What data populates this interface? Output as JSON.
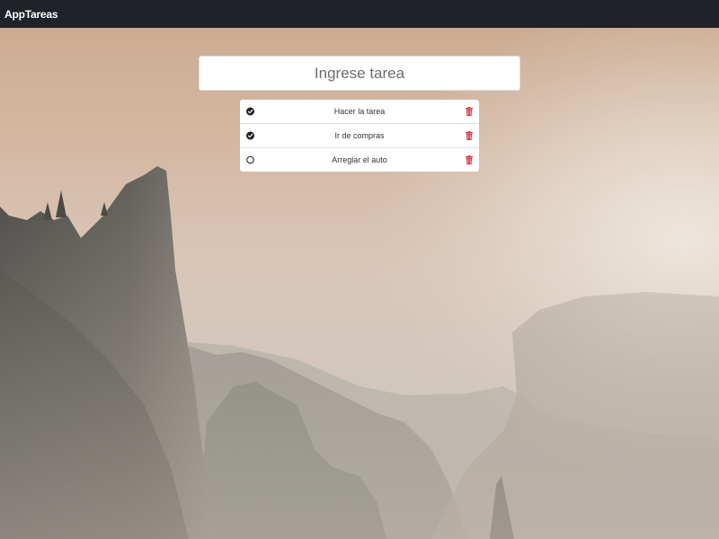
{
  "navbar": {
    "brand": "AppTareas"
  },
  "task_input": {
    "placeholder": "Ingrese tarea",
    "value": ""
  },
  "tasks": [
    {
      "text": "Hacer la tarea",
      "completed": true
    },
    {
      "text": "Ir de compras",
      "completed": true
    },
    {
      "text": "Arreglar el auto",
      "completed": false
    }
  ],
  "icons": {
    "status_done": "check-circle-icon",
    "status_pending": "circle-icon",
    "delete": "trash-icon"
  },
  "colors": {
    "navbar": "#1f2228",
    "delete": "#dc3545",
    "check": "#222222"
  }
}
